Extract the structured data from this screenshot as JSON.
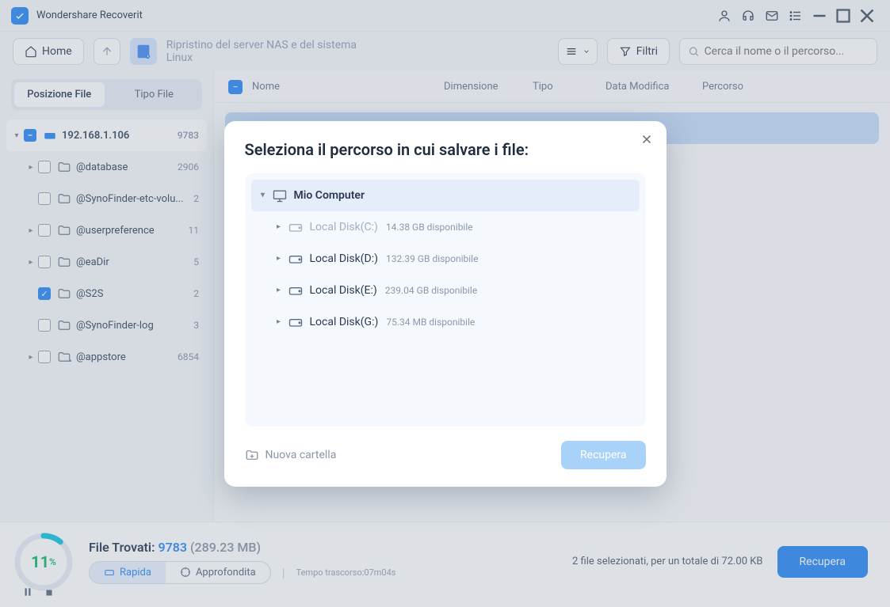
{
  "app": {
    "title": "Wondershare Recoverit"
  },
  "toolbar": {
    "home": "Home",
    "breadcrumb": "Ripristino del server NAS e del sistema Linux",
    "filter": "Filtri",
    "search_placeholder": "Cerca il nome o il percorso..."
  },
  "sidebar": {
    "tabs": {
      "location": "Posizione File",
      "type": "Tipo File"
    },
    "root": {
      "name": "192.168.1.106",
      "count": "9783"
    },
    "items": [
      {
        "name": "@database",
        "count": "2906"
      },
      {
        "name": "@SynoFinder-etc-volu...",
        "count": "2"
      },
      {
        "name": "@userpreference",
        "count": "11"
      },
      {
        "name": "@eaDir",
        "count": "5"
      },
      {
        "name": "@S2S",
        "count": "2"
      },
      {
        "name": "@SynoFinder-log",
        "count": "3"
      },
      {
        "name": "@appstore",
        "count": "6854"
      }
    ]
  },
  "list": {
    "headers": {
      "name": "Nome",
      "size": "Dimensione",
      "type": "Tipo",
      "date": "Data Modifica",
      "path": "Percorso"
    },
    "allchk": "−"
  },
  "modal": {
    "title": "Seleziona il percorso in cui salvare i file:",
    "root": "Mio Computer",
    "drives": [
      {
        "name": "Local Disk(C:)",
        "avail": "14.38 GB disponibile"
      },
      {
        "name": "Local Disk(D:)",
        "avail": "132.39 GB disponibile"
      },
      {
        "name": "Local Disk(E:)",
        "avail": "239.04 GB disponibile"
      },
      {
        "name": "Local Disk(G:)",
        "avail": "75.34 MB disponibile"
      }
    ],
    "new_folder": "Nuova cartella",
    "recover": "Recupera"
  },
  "bottom": {
    "percent": "11",
    "found_label": "File Trovati: ",
    "found_count": "9783",
    "found_size": " (289.23 MB)",
    "quick": "Rapida",
    "deep": "Approfondita",
    "elapsed": "Tempo trascorso:07m04s",
    "selected_info": "2 file selezionati, per un totale di 72.00 KB",
    "recover": "Recupera"
  }
}
